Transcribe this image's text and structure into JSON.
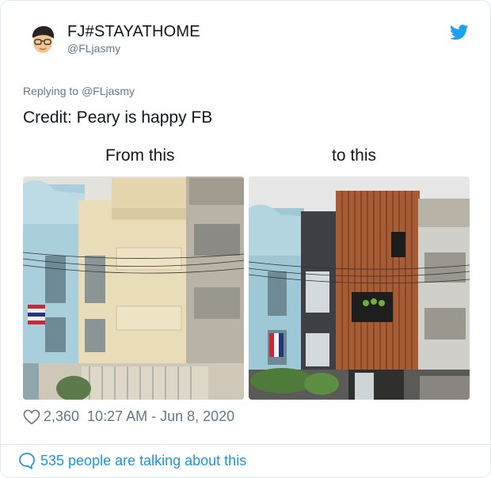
{
  "tweet": {
    "display_name": "FJ#STAYATHOME",
    "handle": "@FLjasmy",
    "replying_prefix": "Replying to",
    "replying_handle": "@FLjasmy",
    "text": "Credit: Peary is happy FB",
    "caption_left": "From this",
    "caption_right": "to this",
    "likes": "2,360",
    "timestamp": "10:27 AM - Jun 8, 2020",
    "conversation": "535 people are talking about this"
  },
  "icons": {
    "brand": "twitter-bird-icon",
    "like": "heart-outline-icon",
    "reply": "speech-bubble-icon"
  },
  "colors": {
    "accent": "#1da1f2",
    "link": "#1b95e0",
    "muted": "#657786",
    "text": "#14171a",
    "border": "#e1e8ed"
  }
}
